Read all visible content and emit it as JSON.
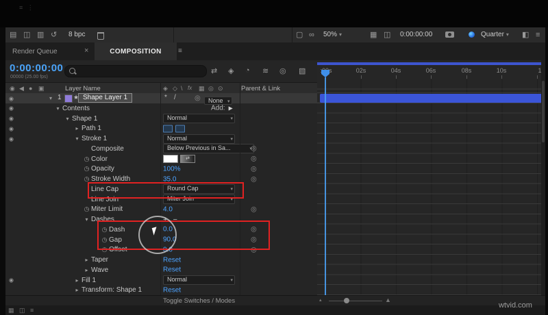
{
  "toolbar": {
    "bpc_label": "8 bpc",
    "zoom_value": "50%",
    "timecode": "0:00:00:00",
    "resolution_value": "Quarter"
  },
  "tabs": {
    "render_queue": "Render Queue",
    "render_queue_close": "×",
    "composition": "COMPOSITION"
  },
  "time_display": {
    "current": "0:00:00:00",
    "frames_fps": "00000 (25.00 fps)"
  },
  "columns": {
    "layer_name": "Layer Name",
    "parent_link": "Parent & Link"
  },
  "layer": {
    "index": "1",
    "name": "Shape Layer 1",
    "parent_value": "None"
  },
  "tree": {
    "add_label": "Add:",
    "plus": "+",
    "minus": "−",
    "rows": [
      {
        "label": "Contents",
        "value": ""
      },
      {
        "label": "Shape 1",
        "value": "Normal"
      },
      {
        "label": "Path 1",
        "value": ""
      },
      {
        "label": "Stroke 1",
        "value": "Normal"
      },
      {
        "label": "Composite",
        "value": "Below Previous in Sa..."
      },
      {
        "label": "Color",
        "value": ""
      },
      {
        "label": "Opacity",
        "value": "100%"
      },
      {
        "label": "Stroke Width",
        "value": "35.0"
      },
      {
        "label": "Line Cap",
        "value": "Round Cap"
      },
      {
        "label": "Line Join",
        "value": "Miter Join"
      },
      {
        "label": "Miter Limit",
        "value": "4.0"
      },
      {
        "label": "Dashes",
        "value": ""
      },
      {
        "label": "Dash",
        "value": "0.0"
      },
      {
        "label": "Gap",
        "value": "90.0"
      },
      {
        "label": "Offset",
        "value": "0.0"
      },
      {
        "label": "Taper",
        "value": "Reset"
      },
      {
        "label": "Wave",
        "value": "Reset"
      },
      {
        "label": "Fill 1",
        "value": "Normal"
      },
      {
        "label": "Transform: Shape 1",
        "value": "Reset"
      }
    ]
  },
  "ruler": {
    "ticks": [
      ":00s",
      "02s",
      "04s",
      "06s",
      "08s",
      "10s",
      "1"
    ]
  },
  "bottom_bar": {
    "toggle_label": "Toggle Switches / Modes"
  },
  "watermark": "wtvid.com",
  "colors": {
    "accent_blue": "#4aa3f8",
    "value_blue": "#4da3ff",
    "highlight_red": "#e22222",
    "layer_bar_blue": "#3b55d8"
  }
}
